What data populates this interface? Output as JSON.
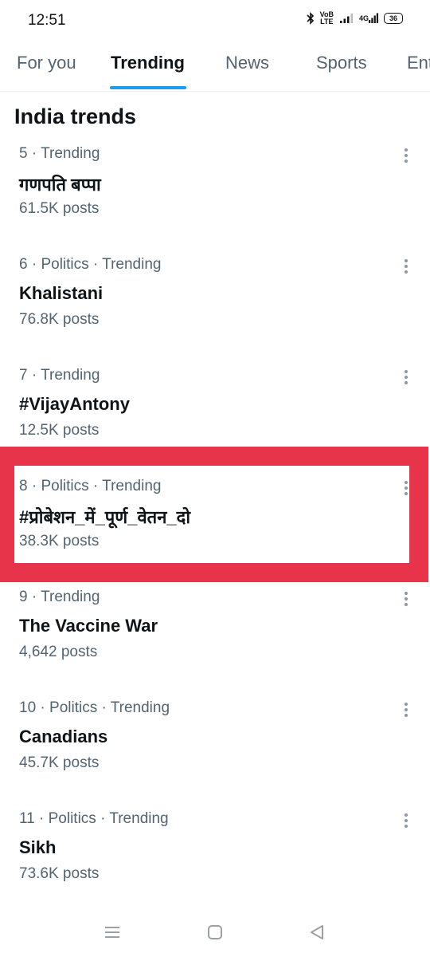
{
  "status_bar": {
    "time": "12:51",
    "network_label_top": "VoB",
    "network_label_bottom": "LTE",
    "network_type": "4G",
    "battery": "36",
    "icons": [
      "bluetooth-icon",
      "volte-icon",
      "signal-icon",
      "signal-4g-icon",
      "battery-icon"
    ]
  },
  "tabs": [
    {
      "label": "For you",
      "active": false
    },
    {
      "label": "Trending",
      "active": true
    },
    {
      "label": "News",
      "active": false
    },
    {
      "label": "Sports",
      "active": false
    },
    {
      "label": "Ent",
      "active": false
    }
  ],
  "section_title": "India trends",
  "trends": [
    {
      "meta": "5 · Trending",
      "name": "गणपति बप्पा",
      "posts": "61.5K posts"
    },
    {
      "meta": "6 · Politics · Trending",
      "name": "Khalistani",
      "posts": "76.8K posts"
    },
    {
      "meta": "7 · Trending",
      "name": "#VijayAntony",
      "posts": "12.5K posts"
    },
    {
      "meta": "8 · Politics · Trending",
      "name": "#प्रोबेशन_में_पूर्ण_वेतन_दो",
      "posts": "38.3K posts",
      "highlighted": true
    },
    {
      "meta": "9 · Trending",
      "name": "The Vaccine War",
      "posts": "4,642 posts"
    },
    {
      "meta": "10 · Politics · Trending",
      "name": "Canadians",
      "posts": "45.7K posts"
    },
    {
      "meta": "11 · Politics · Trending",
      "name": "Sikh",
      "posts": "73.6K posts"
    }
  ],
  "colors": {
    "accent": "#1d9bf0",
    "highlight_box": "#e8344a",
    "primary_text": "#0f1419",
    "secondary_text": "#536471"
  },
  "nav_bar": {
    "icons": [
      "recent-apps-icon",
      "home-icon",
      "back-icon"
    ]
  }
}
